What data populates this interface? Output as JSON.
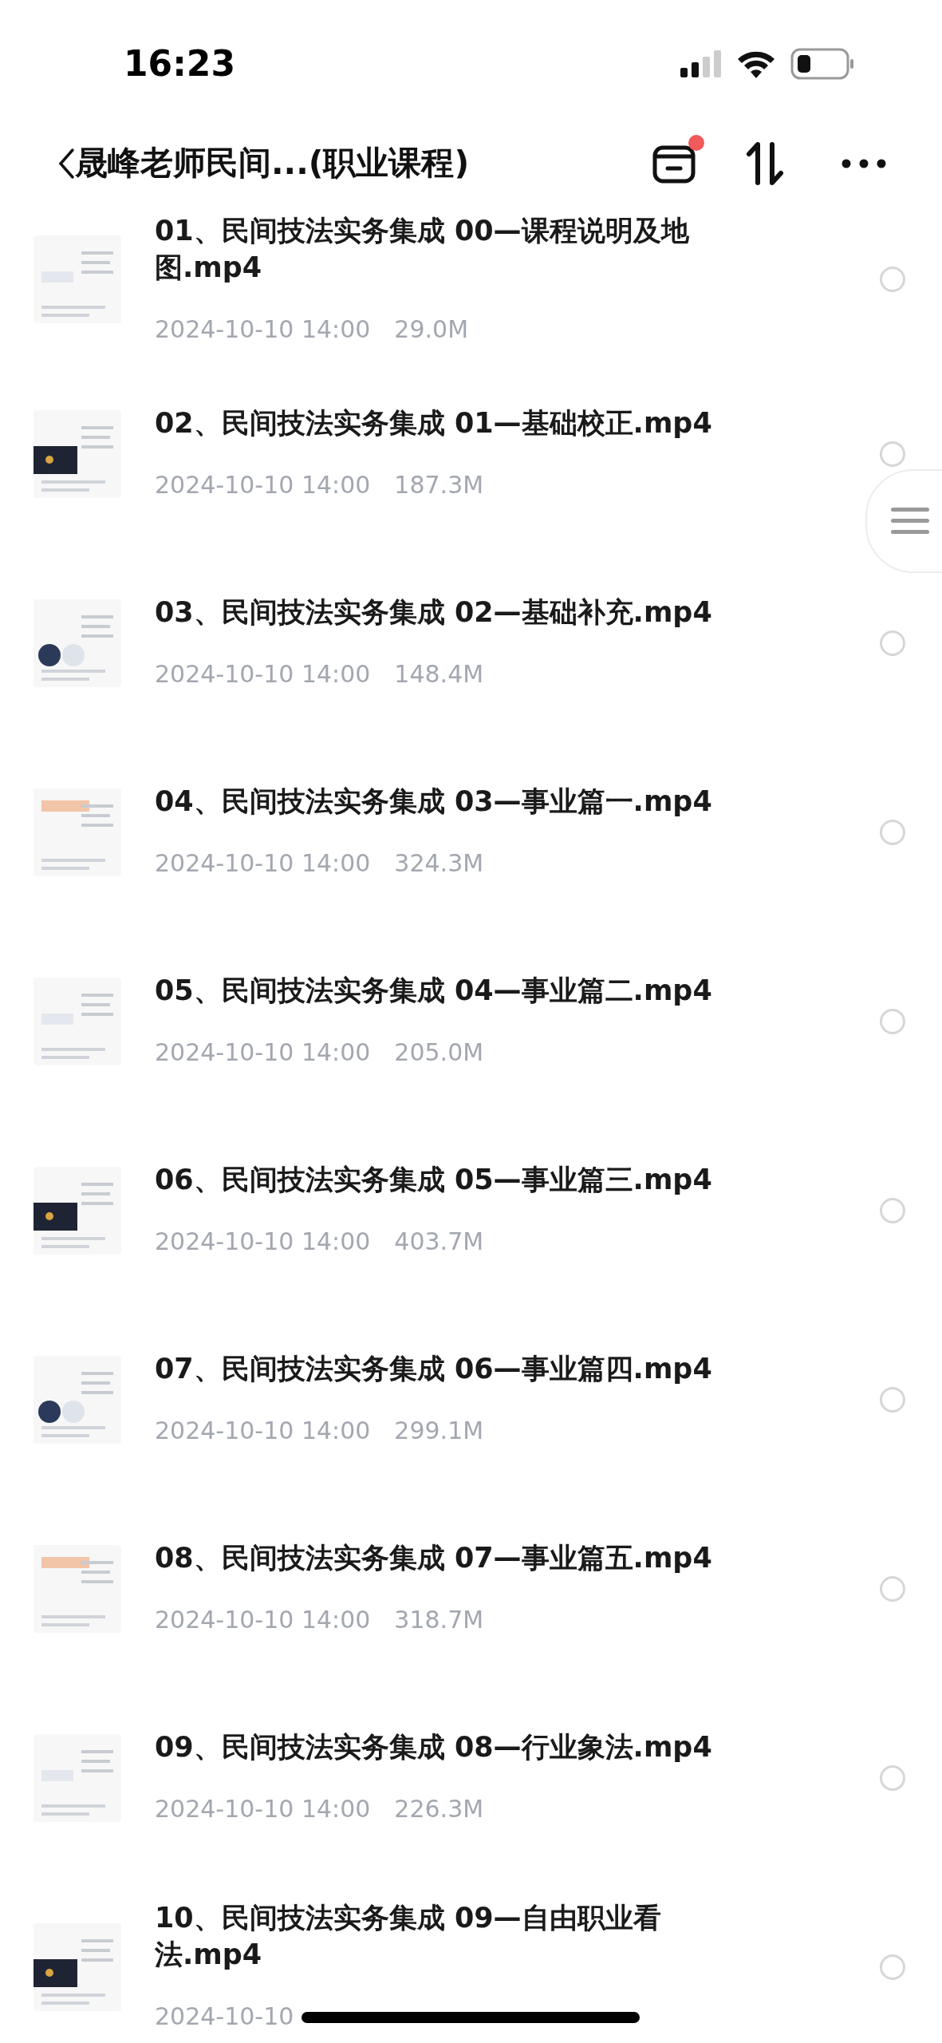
{
  "status_bar": {
    "time": "16:23"
  },
  "header": {
    "title": "晟峰老师民间...(职业课程)",
    "notification_dot": true
  },
  "files": [
    {
      "title": "01、民间技法实务集成 00—课程说明及地图.mp4",
      "date": "2024-10-10 14:00",
      "size": "29.0M",
      "selected": false
    },
    {
      "title": "02、民间技法实务集成 01—基础校正.mp4",
      "date": "2024-10-10 14:00",
      "size": "187.3M",
      "selected": false
    },
    {
      "title": "03、民间技法实务集成 02—基础补充.mp4",
      "date": "2024-10-10 14:00",
      "size": "148.4M",
      "selected": false
    },
    {
      "title": "04、民间技法实务集成 03—事业篇一.mp4",
      "date": "2024-10-10 14:00",
      "size": "324.3M",
      "selected": false
    },
    {
      "title": "05、民间技法实务集成 04—事业篇二.mp4",
      "date": "2024-10-10 14:00",
      "size": "205.0M",
      "selected": false
    },
    {
      "title": "06、民间技法实务集成 05—事业篇三.mp4",
      "date": "2024-10-10 14:00",
      "size": "403.7M",
      "selected": false
    },
    {
      "title": "07、民间技法实务集成 06—事业篇四.mp4",
      "date": "2024-10-10 14:00",
      "size": "299.1M",
      "selected": false
    },
    {
      "title": "08、民间技法实务集成 07—事业篇五.mp4",
      "date": "2024-10-10 14:00",
      "size": "318.7M",
      "selected": false
    },
    {
      "title": "09、民间技法实务集成 08—行业象法.mp4",
      "date": "2024-10-10 14:00",
      "size": "226.3M",
      "selected": false
    },
    {
      "title": "10、民间技法实务集成 09—自由职业看法.mp4",
      "date": "2024-10-10",
      "selected": false
    }
  ]
}
